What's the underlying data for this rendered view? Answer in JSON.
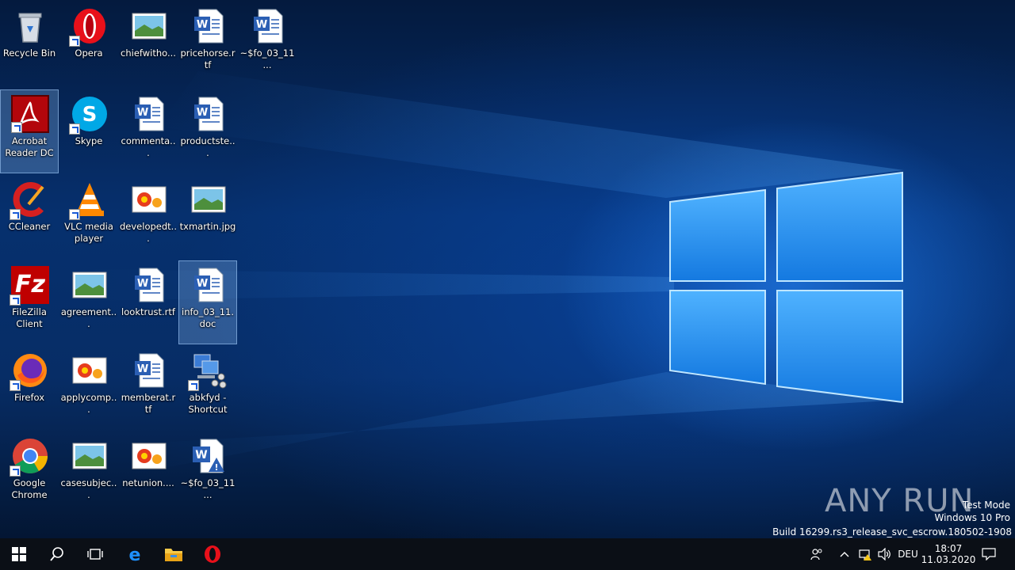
{
  "desktop_icons": [
    {
      "id": "recycle",
      "label": "Recycle Bin"
    },
    {
      "id": "acrobat",
      "label": "Acrobat Reader DC"
    },
    {
      "id": "ccleaner",
      "label": "CCleaner"
    },
    {
      "id": "filezilla",
      "label": "FileZilla Client"
    },
    {
      "id": "firefox",
      "label": "Firefox"
    },
    {
      "id": "chrome",
      "label": "Google Chrome"
    },
    {
      "id": "opera",
      "label": "Opera"
    },
    {
      "id": "skype",
      "label": "Skype"
    },
    {
      "id": "vlc",
      "label": "VLC media player"
    },
    {
      "id": "agreement",
      "label": "agreement..."
    },
    {
      "id": "applycomp",
      "label": "applycomp..."
    },
    {
      "id": "casesubjec",
      "label": "casesubjec..."
    },
    {
      "id": "chiefwitho",
      "label": "chiefwitho..."
    },
    {
      "id": "commenta",
      "label": "commenta..."
    },
    {
      "id": "developedt",
      "label": "developedt..."
    },
    {
      "id": "looktrust",
      "label": "looktrust.rtf"
    },
    {
      "id": "memberat",
      "label": "memberat.rtf"
    },
    {
      "id": "netunion",
      "label": "netunion...."
    },
    {
      "id": "pricehorse",
      "label": "pricehorse.rtf"
    },
    {
      "id": "productste",
      "label": "productste..."
    },
    {
      "id": "txmartin",
      "label": "txmartin.jpg"
    },
    {
      "id": "info",
      "label": "info_03_11.doc"
    },
    {
      "id": "abkfyd",
      "label": "abkfyd - Shortcut"
    },
    {
      "id": "fo_tmp_a",
      "label": "~$fo_03_11..."
    },
    {
      "id": "fo_tmp_b",
      "label": "~$fo_03_11..."
    }
  ],
  "watermark": {
    "brand": "ANY RUN",
    "test_mode": "Test Mode",
    "edition": "Windows 10 Pro",
    "build": "Build 16299.rs3_release_svc_escrow.180502-1908"
  },
  "taskbar": {
    "language": "DEU",
    "time": "18:07",
    "date": "11.03.2020"
  },
  "colors": {
    "accent": "#1a7bd6",
    "taskbar": "#0b0f16"
  }
}
